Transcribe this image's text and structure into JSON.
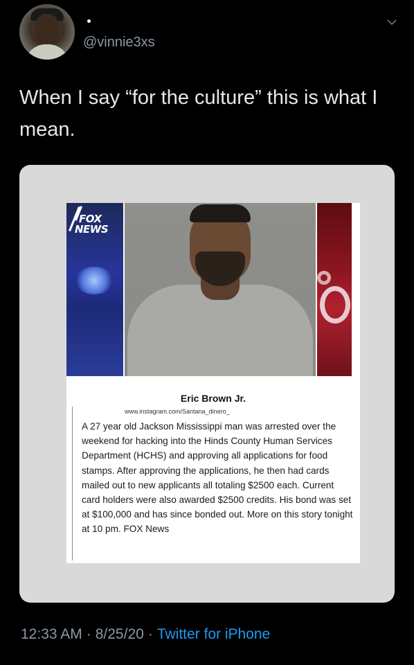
{
  "user": {
    "handle": "@vinnie3xs",
    "name_dot": "."
  },
  "tweet": {
    "text": "When I say “for the culture” this is what I mean."
  },
  "media": {
    "logo_line1": "FOX",
    "logo_line2": "NEWS",
    "person_name": "Eric Brown Jr.",
    "source_url": "www.instagram.com/Santana_dinero_",
    "story": "A 27 year old Jackson Mississippi man was arrested over the weekend for hacking into the Hinds County Human Services Department (HCHS) and approving all applications for food stamps. After approving the applications, he then had cards mailed out to new applicants all totaling $2500 each. Current card holders were also awarded $2500 credits. His bond was set at $100,000 and has since bonded out. More on this story tonight at 10 pm. FOX News"
  },
  "footer": {
    "time": "12:33 AM",
    "date": "8/25/20",
    "separator": "·",
    "source": "Twitter for iPhone"
  },
  "colors": {
    "background": "#000000",
    "secondary_text": "#8b98a5",
    "link": "#1d9bf0"
  },
  "icons": {
    "menu": "chevron-down-icon"
  }
}
